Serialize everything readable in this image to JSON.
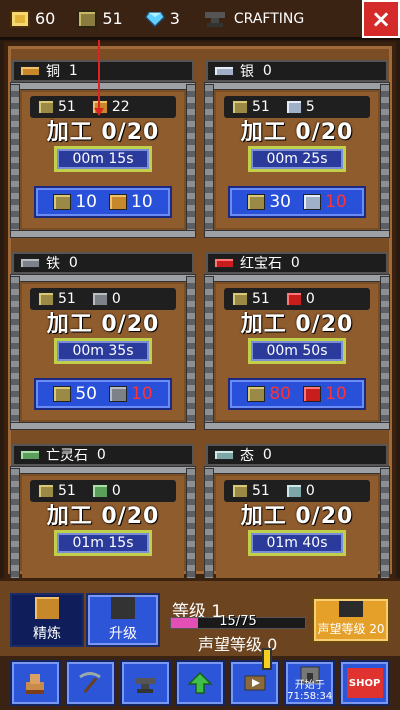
{
  "resources": {
    "gold": "60",
    "wood": "51",
    "gems": "3"
  },
  "title": "CRAFTING",
  "close_label": "×",
  "panels": [
    {
      "name": "铜",
      "count": "1",
      "need_a": "51",
      "need_b": "22",
      "process": "加工 0/20",
      "timer": "00m 15s",
      "cost_a": "10",
      "cost_b": "10",
      "cost_b_short": false,
      "icon": "copper-ore-icon"
    },
    {
      "name": "银",
      "count": "0",
      "need_a": "51",
      "need_b": "5",
      "process": "加工 0/20",
      "timer": "00m 25s",
      "cost_a": "30",
      "cost_b": "10",
      "cost_b_short": true,
      "icon": "silver-ore-icon"
    },
    {
      "name": "铁",
      "count": "0",
      "need_a": "51",
      "need_b": "0",
      "process": "加工 0/20",
      "timer": "00m 35s",
      "cost_a": "50",
      "cost_b": "10",
      "cost_b_short": true,
      "icon": "iron-ore-icon"
    },
    {
      "name": "红宝石",
      "count": "0",
      "need_a": "51",
      "need_b": "0",
      "process": "加工 0/20",
      "timer": "00m 50s",
      "cost_a": "80",
      "cost_b": "10",
      "cost_b_short": true,
      "icon": "ruby-icon"
    },
    {
      "name": "亡灵石",
      "count": "0",
      "need_a": "51",
      "need_b": "0",
      "process": "加工 0/20",
      "timer": "01m 15s",
      "icon": "soul-stone-icon"
    },
    {
      "name": "态",
      "count": "0",
      "need_a": "51",
      "need_b": "0",
      "process": "加工 0/20",
      "timer": "01m 40s",
      "icon": "state-stone-icon"
    }
  ],
  "tabs": {
    "refine": "精炼",
    "upgrade": "升级"
  },
  "level": {
    "label": "等级 1",
    "xp": "15/75",
    "xp_fraction": 0.2,
    "reputation": "声望等级 0"
  },
  "reputation_button": "声望等级 20",
  "nav": {
    "start_label": "开始于",
    "start_time": "71:58:34",
    "shop": "SHOP"
  }
}
